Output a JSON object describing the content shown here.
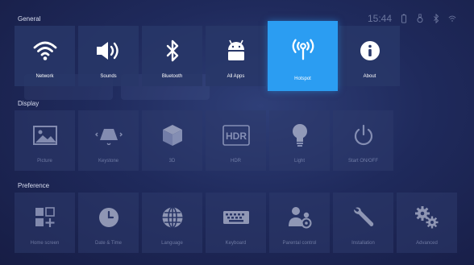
{
  "status": {
    "time": "15:44"
  },
  "sections": {
    "general": "General",
    "display": "Display",
    "preference": "Preference"
  },
  "general_tiles": [
    {
      "label": "Network",
      "icon": "wifi-icon"
    },
    {
      "label": "Sounds",
      "icon": "speaker-icon"
    },
    {
      "label": "Bluetooth",
      "icon": "bluetooth-icon"
    },
    {
      "label": "All Apps",
      "icon": "android-icon"
    },
    {
      "label": "Hotspot",
      "icon": "hotspot-icon"
    },
    {
      "label": "About",
      "icon": "info-icon"
    }
  ],
  "display_tiles": [
    {
      "label": "Picture",
      "icon": "picture-icon"
    },
    {
      "label": "Keystone",
      "icon": "keystone-icon"
    },
    {
      "label": "3D",
      "icon": "cube-icon"
    },
    {
      "label": "HDR",
      "icon": "hdr-icon"
    },
    {
      "label": "Light",
      "icon": "bulb-icon"
    },
    {
      "label": "Start ON/OFF",
      "icon": "power-icon"
    }
  ],
  "preference_tiles": [
    {
      "label": "Home screen",
      "icon": "grid-add-icon"
    },
    {
      "label": "Date & Time",
      "icon": "clock-icon"
    },
    {
      "label": "Language",
      "icon": "globe-icon"
    },
    {
      "label": "Keyboard",
      "icon": "keyboard-icon"
    },
    {
      "label": "Parental control",
      "icon": "parental-icon"
    },
    {
      "label": "Installation",
      "icon": "wrench-icon"
    },
    {
      "label": "Advanced",
      "icon": "gears-icon"
    }
  ],
  "colors": {
    "selected": "#2b9df2",
    "background": "#1f2a5c"
  }
}
